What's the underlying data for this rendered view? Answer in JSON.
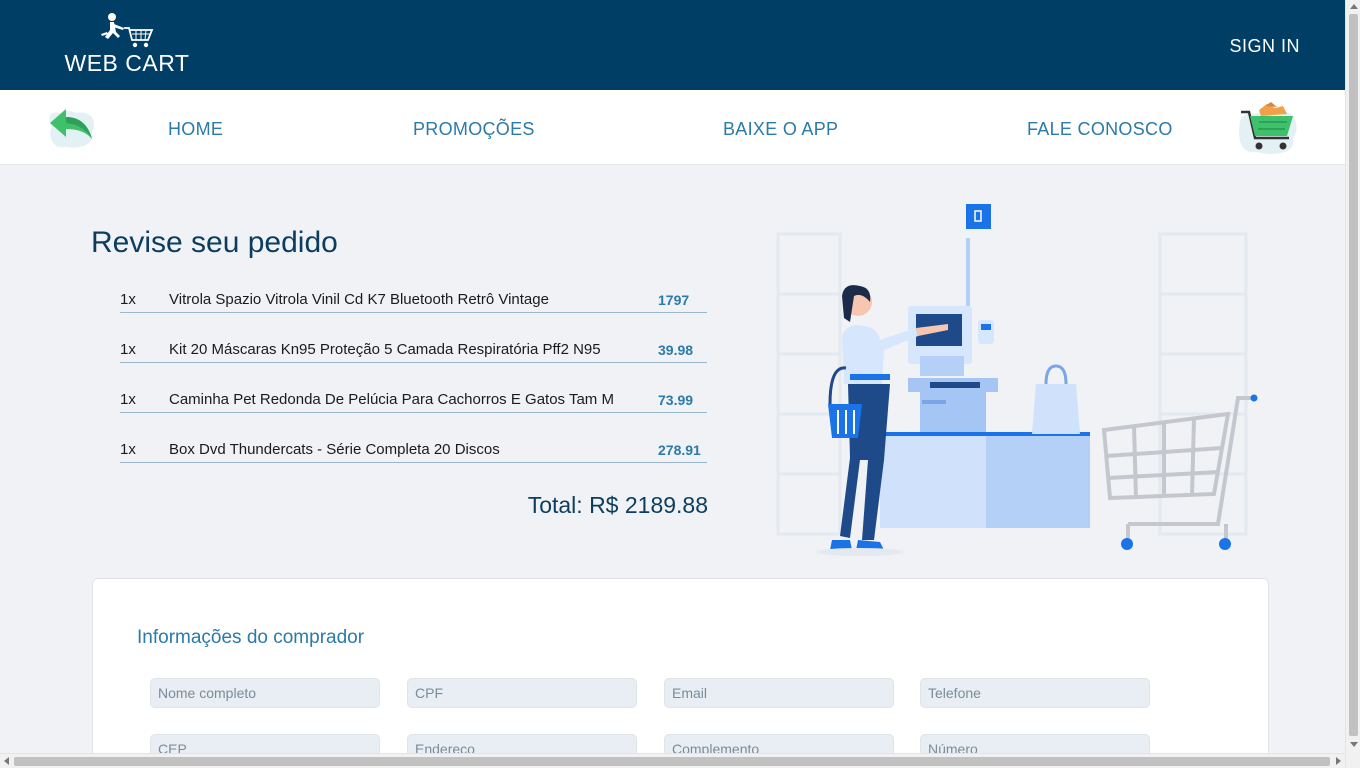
{
  "header": {
    "logo_text": "WEB CART",
    "signin_label": "SIGN IN"
  },
  "nav": {
    "items": [
      {
        "label": "HOME"
      },
      {
        "label": "PROMOÇÕES"
      },
      {
        "label": "BAIXE O APP"
      },
      {
        "label": "FALE CONOSCO"
      }
    ]
  },
  "review": {
    "title": "Revise seu pedido",
    "items": [
      {
        "qty": "1x",
        "name": "Vitrola Spazio Vitrola Vinil Cd K7 Bluetooth Retrô Vintage",
        "price": "1797"
      },
      {
        "qty": "1x",
        "name": "Kit 20 Máscaras Kn95 Proteção 5 Camada Respiratória Pff2 N95",
        "price": "39.98"
      },
      {
        "qty": "1x",
        "name": "Caminha Pet Redonda De Pelúcia Para Cachorros E Gatos Tam M",
        "price": "73.99"
      },
      {
        "qty": "1x",
        "name": "Box Dvd Thundercats - Série Completa 20 Discos",
        "price": "278.91"
      }
    ],
    "total": "Total: R$ 2189.88"
  },
  "buyer": {
    "title": "Informações do comprador",
    "fields": [
      {
        "placeholder": "Nome completo",
        "value": ""
      },
      {
        "placeholder": "CPF",
        "value": ""
      },
      {
        "placeholder": "Email",
        "value": ""
      },
      {
        "placeholder": "Telefone",
        "value": ""
      },
      {
        "placeholder": "CEP",
        "value": ""
      },
      {
        "placeholder": "Endereço",
        "value": ""
      },
      {
        "placeholder": "Complemento",
        "value": ""
      },
      {
        "placeholder": "Número",
        "value": ""
      }
    ]
  },
  "colors": {
    "header_bg": "#003e66",
    "nav_link": "#2b7aa8",
    "title": "#0c3d5e",
    "accent_green": "#3fc06a"
  },
  "icons": {
    "logo": "shopper-cart-icon",
    "back": "back-arrow-icon",
    "cart": "shopping-cart-icon",
    "illustration": "self-checkout-illustration"
  }
}
